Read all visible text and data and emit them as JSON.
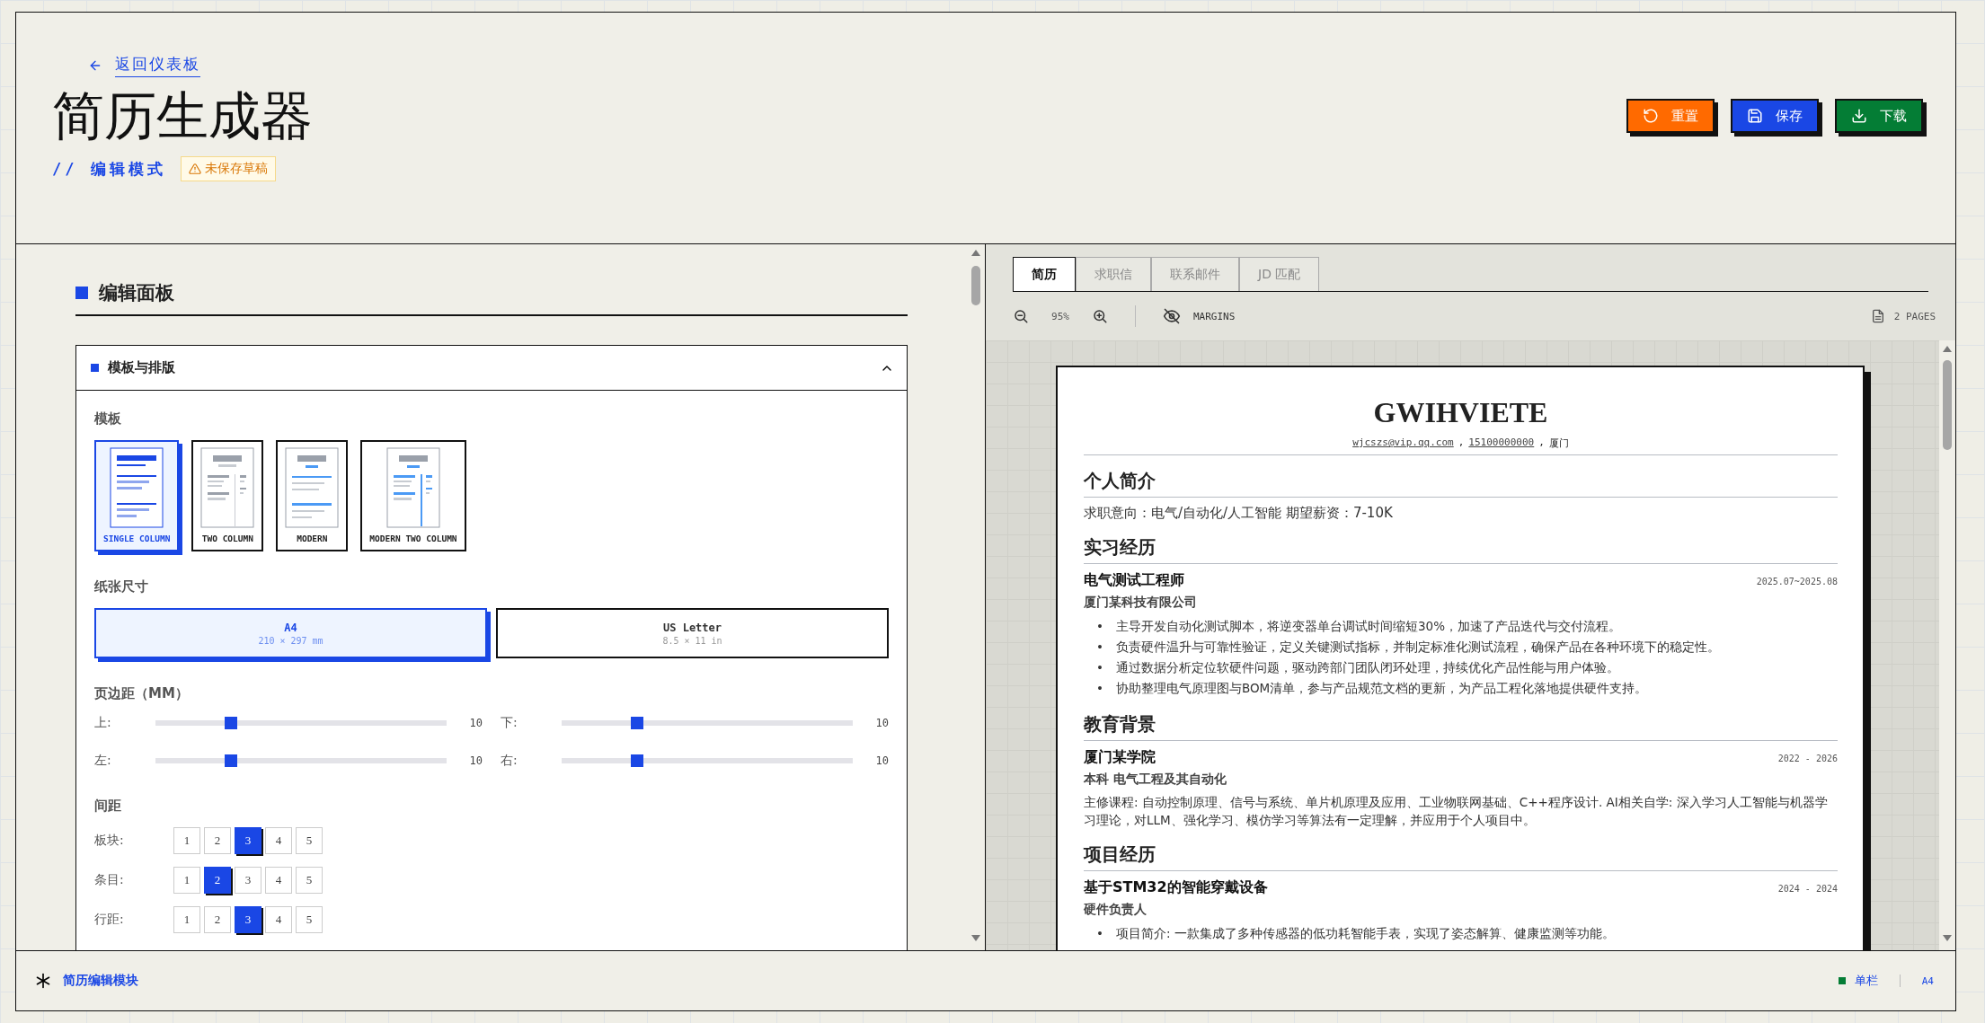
{
  "header": {
    "back_link": "返回仪表板",
    "title": "简历生成器",
    "mode": "// 编辑模式",
    "draft_badge": "未保存草稿",
    "buttons": [
      {
        "kind": "reset",
        "label": "重置"
      },
      {
        "kind": "save",
        "label": "保存"
      },
      {
        "kind": "download",
        "label": "下载"
      }
    ]
  },
  "editor": {
    "title": "编辑面板",
    "section": {
      "title": "模板与排版",
      "expanded": true,
      "template_label": "模板",
      "templates": [
        {
          "kind": "single",
          "name": "SINGLE COLUMN",
          "selected": true
        },
        {
          "kind": "two",
          "name": "TWO COLUMN",
          "selected": false
        },
        {
          "kind": "modern",
          "name": "MODERN",
          "selected": false
        },
        {
          "kind": "modern-two",
          "name": "MODERN TWO COLUMN",
          "selected": false
        }
      ],
      "paper_label": "纸张尺寸",
      "papers": [
        {
          "name": "A4",
          "size": "210 × 297 mm",
          "selected": true
        },
        {
          "name": "US Letter",
          "size": "8.5 × 11 in",
          "selected": false
        }
      ],
      "margins_label": "页边距（MM）",
      "margins": [
        {
          "label": "上:",
          "value": "10",
          "level": 0.26
        },
        {
          "label": "下:",
          "value": "10",
          "level": 0.26
        },
        {
          "label": "左:",
          "value": "10",
          "level": 0.26
        },
        {
          "label": "右:",
          "value": "10",
          "level": 0.26
        }
      ],
      "spacing_label": "间距",
      "spacing": [
        {
          "label": "板块:",
          "options": [
            {
              "text": "1",
              "selected": false
            },
            {
              "text": "2",
              "selected": false
            },
            {
              "text": "3",
              "selected": true
            },
            {
              "text": "4",
              "selected": false
            },
            {
              "text": "5",
              "selected": false
            }
          ]
        },
        {
          "label": "条目:",
          "options": [
            {
              "text": "1",
              "selected": false
            },
            {
              "text": "2",
              "selected": true
            },
            {
              "text": "3",
              "selected": false
            },
            {
              "text": "4",
              "selected": false
            },
            {
              "text": "5",
              "selected": false
            }
          ]
        },
        {
          "label": "行距:",
          "options": [
            {
              "text": "1",
              "selected": false
            },
            {
              "text": "2",
              "selected": false
            },
            {
              "text": "3",
              "selected": true
            },
            {
              "text": "4",
              "selected": false
            },
            {
              "text": "5",
              "selected": false
            }
          ]
        }
      ]
    }
  },
  "preview": {
    "tabs": [
      {
        "label": "简历",
        "selected": true
      },
      {
        "label": "求职信",
        "selected": false
      },
      {
        "label": "联系邮件",
        "selected": false
      },
      {
        "label": "JD 匹配",
        "selected": false
      }
    ],
    "zoom": "95%",
    "margins_toggle": "MARGINS",
    "pages": "2 PAGES",
    "resume": {
      "name": "GWIHVIETE",
      "separator": ",",
      "bullet_marker": "•",
      "contacts": [
        {
          "text": "wjcszs@vip.qq.com",
          "link": true
        },
        {
          "text": "15100000000",
          "link": true
        },
        {
          "text": "厦门",
          "link": false
        }
      ],
      "sections": [
        {
          "title": "个人简介",
          "entries": [
            {
              "kind": "text",
              "text": "求职意向：电气/自动化/人工智能 期望薪资：7-10K"
            }
          ]
        },
        {
          "title": "实习经历",
          "entries": [
            {
              "kind": "item",
              "title": "电气测试工程师",
              "date": "2025.07~2025.08",
              "subtitle": "厦门某科技有限公司",
              "bullets": [
                "主导开发自动化测试脚本，将逆变器单台调试时间缩短30%，加速了产品迭代与交付流程。",
                "负责硬件温升与可靠性验证，定义关键测试指标，并制定标准化测试流程，确保产品在各种环境下的稳定性。",
                "通过数据分析定位软硬件问题，驱动跨部门团队闭环处理，持续优化产品性能与用户体验。",
                "协助整理电气原理图与BOM清单，参与产品规范文档的更新，为产品工程化落地提供硬件支持。"
              ]
            }
          ]
        },
        {
          "title": "教育背景",
          "entries": [
            {
              "kind": "item",
              "title": "厦门某学院",
              "date": "2022 - 2026",
              "subtitle": "本科 电气工程及其自动化",
              "description": "主修课程: 自动控制原理、信号与系统、单片机原理及应用、工业物联网基础、C++程序设计. AI相关自学: 深入学习人工智能与机器学习理论，对LLM、强化学习、模仿学习等算法有一定理解，并应用于个人项目中。"
            }
          ]
        },
        {
          "title": "项目经历",
          "entries": [
            {
              "kind": "item",
              "title": "基于STM32的智能穿戴设备",
              "date": "2024 - 2024",
              "subtitle": "硬件负责人",
              "bullets": [
                "项目简介: 一款集成了多种传感器的低功耗智能手表，实现了姿态解算、健康监测等功能。"
              ]
            }
          ]
        }
      ]
    }
  },
  "footer": {
    "title": "简历编辑模块",
    "layout": "单栏",
    "paper": "A4"
  }
}
